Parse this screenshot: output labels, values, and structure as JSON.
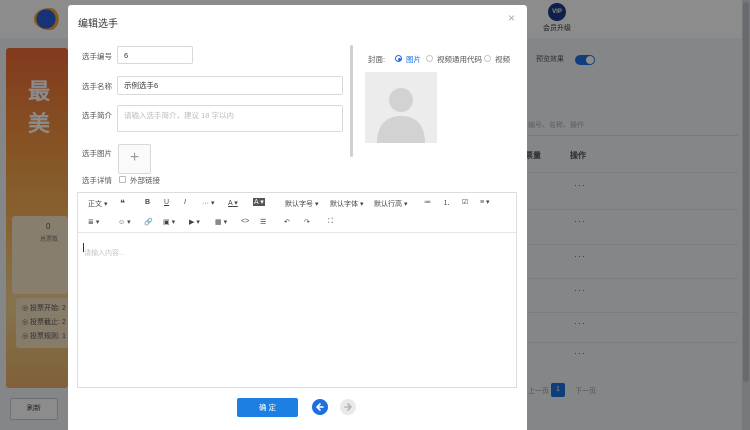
{
  "background": {
    "big_text": "最美",
    "vip_label": "会员升级",
    "card_count": "0",
    "card_label": "总票数",
    "info": [
      "◎ 投票开始: 2",
      "◎ 投票截止: 2",
      "◎ 投票规则: 1"
    ],
    "refresh_label": "刷新",
    "preview_label": "预览效果",
    "filter_placeholder": "编号、名称、操作",
    "col_votes": "票量",
    "col_actions": "操作",
    "row_dots": "···",
    "pager_prev": "上一页",
    "pager_current": "1",
    "pager_next": "下一页"
  },
  "modal": {
    "title": "编辑选手",
    "close_glyph": "×",
    "fields": {
      "number_label": "选手编号",
      "number_value": "6",
      "name_label": "选手名称",
      "name_value": "示例选手6",
      "intro_label": "选手简介",
      "intro_placeholder": "请输入选手简介，建议 18 字以内",
      "image_label": "选手图片",
      "upload_glyph": "+",
      "detail_label": "选手详情",
      "external_link_label": "外部链接"
    },
    "cover": {
      "label": "封面:",
      "options": [
        "图片",
        "视频通用代码",
        "视频"
      ],
      "selected": "图片"
    },
    "editor": {
      "toolbar_row1": [
        "正文",
        "❝",
        "B",
        "U",
        "I",
        "···",
        "A",
        "A",
        "默认字号",
        "默认字体",
        "默认行高",
        "≔",
        "⒈",
        "☑",
        "≡"
      ],
      "toolbar_row2": [
        "≣",
        "☺",
        "🔗",
        "▣",
        "▶",
        "▦",
        "<>",
        "☰",
        "↶",
        "↷",
        "⛶"
      ],
      "placeholder": "请输入内容..."
    },
    "confirm_label": "确 定",
    "colors": {
      "primary": "#1e7fe3",
      "overlay": "rgba(0,0,0,0.45)"
    }
  }
}
